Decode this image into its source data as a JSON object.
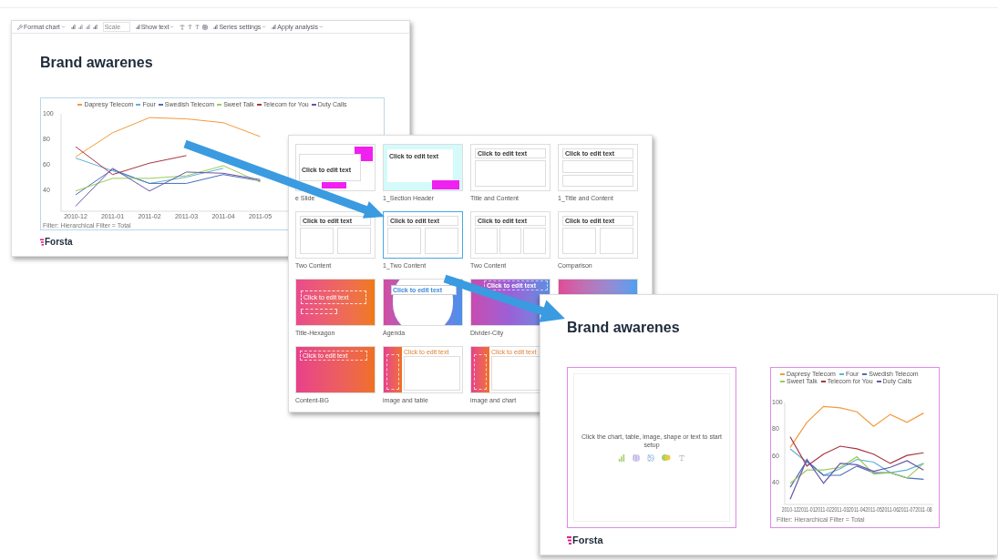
{
  "back_slide": {
    "toolbar": [
      {
        "kind": "menu",
        "label": "Format chart"
      },
      {
        "kind": "icons"
      },
      {
        "kind": "field",
        "placeholder": "Scale"
      },
      {
        "kind": "menu",
        "label": "Show text"
      },
      {
        "kind": "text_icons"
      },
      {
        "kind": "menu",
        "label": "Series settings"
      },
      {
        "kind": "menu",
        "label": "Apply analysis"
      }
    ],
    "title": "Brand awarenes",
    "chart": {
      "chart_data": {
        "type": "line",
        "legend": "top",
        "categories": [
          "2010-12",
          "2011-01",
          "2011-02",
          "2011-03",
          "2011-04",
          "2011-05"
        ],
        "ylim": [
          23,
          100
        ],
        "yticks": [
          40,
          60,
          80,
          100
        ],
        "series": [
          {
            "name": "Dapresy Telecom",
            "color": "#f39a3d",
            "values": [
              66,
              85,
              97,
              96,
              93,
              82
            ]
          },
          {
            "name": "Four",
            "color": "#5fb3d6",
            "values": [
              65,
              55,
              45,
              50,
              57,
              null
            ]
          },
          {
            "name": "Swedish Telecom",
            "color": "#4a6fb8",
            "values": [
              36,
              56,
              45,
              45,
              52,
              47
            ]
          },
          {
            "name": "Sweet Talk",
            "color": "#9ccc5a",
            "values": [
              39,
              49,
              49,
              51,
              59,
              46
            ]
          },
          {
            "name": "Telecom for You",
            "color": "#a8343f",
            "values": [
              74,
              52,
              61,
              67,
              null,
              null
            ]
          },
          {
            "name": "Duty Calls",
            "color": "#6a55a8",
            "values": [
              27,
              57,
              39,
              54,
              53,
              48
            ]
          }
        ]
      }
    },
    "filter_note": "Filter: Hierarchical Filter = Total",
    "logo": "Forsta"
  },
  "layout_picker": {
    "tiles": [
      {
        "kind": "title-logo",
        "label": "e Slide",
        "heading": "Click to edit text",
        "selected": false
      },
      {
        "kind": "section",
        "label": "1_Section Header",
        "heading": "Click to edit text",
        "selected": false
      },
      {
        "kind": "title-content",
        "label": "Title and Content",
        "heading": "Click to edit text",
        "selected": false
      },
      {
        "kind": "title-rows",
        "label": "1_Title and Content",
        "heading": "Click to edit text",
        "selected": false
      },
      {
        "kind": "two-content",
        "label": "Two Content",
        "heading": "Click to edit text",
        "selected": false
      },
      {
        "kind": "two-content",
        "label": "1_Two Content",
        "heading": "Click to edit text",
        "selected": true
      },
      {
        "kind": "three-content",
        "label": "Two Content",
        "heading": "Click to edit text",
        "selected": false
      },
      {
        "kind": "comparison",
        "label": "Comparison",
        "heading": "Click to edit text",
        "selected": false
      },
      {
        "kind": "hexagon",
        "label": "Title-Hexagon",
        "heading": "Click to edit text",
        "selected": false
      },
      {
        "kind": "agenda",
        "label": "Agenda",
        "heading": "Click to edit text",
        "selected": false
      },
      {
        "kind": "city",
        "label": "Divider-City",
        "heading": "Click to edit text",
        "selected": false
      },
      {
        "kind": "gradient",
        "selected": false
      },
      {
        "kind": "content-bg",
        "label": "Content-BG",
        "heading": "Click to edit text",
        "selected": false
      },
      {
        "kind": "image-side",
        "label": "image and table",
        "heading": "Click to edit text",
        "selected": false
      },
      {
        "kind": "image-side",
        "label": "image and chart",
        "heading": "Click to edit text",
        "selected": false
      }
    ]
  },
  "front_slide": {
    "title": "Brand awarenes",
    "placeholder": {
      "prompt": "Click the chart, table, image, shape or text to start setup"
    },
    "chart": {
      "chart_data": {
        "type": "line",
        "legend": "top",
        "categories": [
          "2010-12",
          "2011-01",
          "2011-02",
          "2011-03",
          "2011-04",
          "2011-05",
          "2011-06",
          "2011-07",
          "2011-08"
        ],
        "ylim": [
          23,
          100
        ],
        "yticks": [
          40,
          60,
          80,
          100
        ],
        "series": [
          {
            "name": "Dapresy Telecom",
            "color": "#f39a3d",
            "values": [
              66,
              85,
              97,
              96,
              93,
              82,
              91,
              85,
              92
            ]
          },
          {
            "name": "Four",
            "color": "#5fb3d6",
            "values": [
              65,
              55,
              45,
              50,
              57,
              55,
              47,
              49,
              54
            ]
          },
          {
            "name": "Swedish Telecom",
            "color": "#4a6fb8",
            "values": [
              36,
              56,
              45,
              45,
              52,
              47,
              47,
              43,
              42
            ]
          },
          {
            "name": "Sweet Talk",
            "color": "#9ccc5a",
            "values": [
              39,
              49,
              49,
              51,
              59,
              46,
              47,
              43,
              54
            ]
          },
          {
            "name": "Telecom for You",
            "color": "#a8343f",
            "values": [
              74,
              52,
              61,
              67,
              65,
              61,
              54,
              60,
              62
            ]
          },
          {
            "name": "Duty Calls",
            "color": "#6a55a8",
            "values": [
              27,
              57,
              39,
              54,
              53,
              48,
              51,
              56,
              49
            ]
          }
        ]
      }
    },
    "filter_note": "Filter: Hierarchical Filter = Total",
    "logo": "Forsta"
  }
}
